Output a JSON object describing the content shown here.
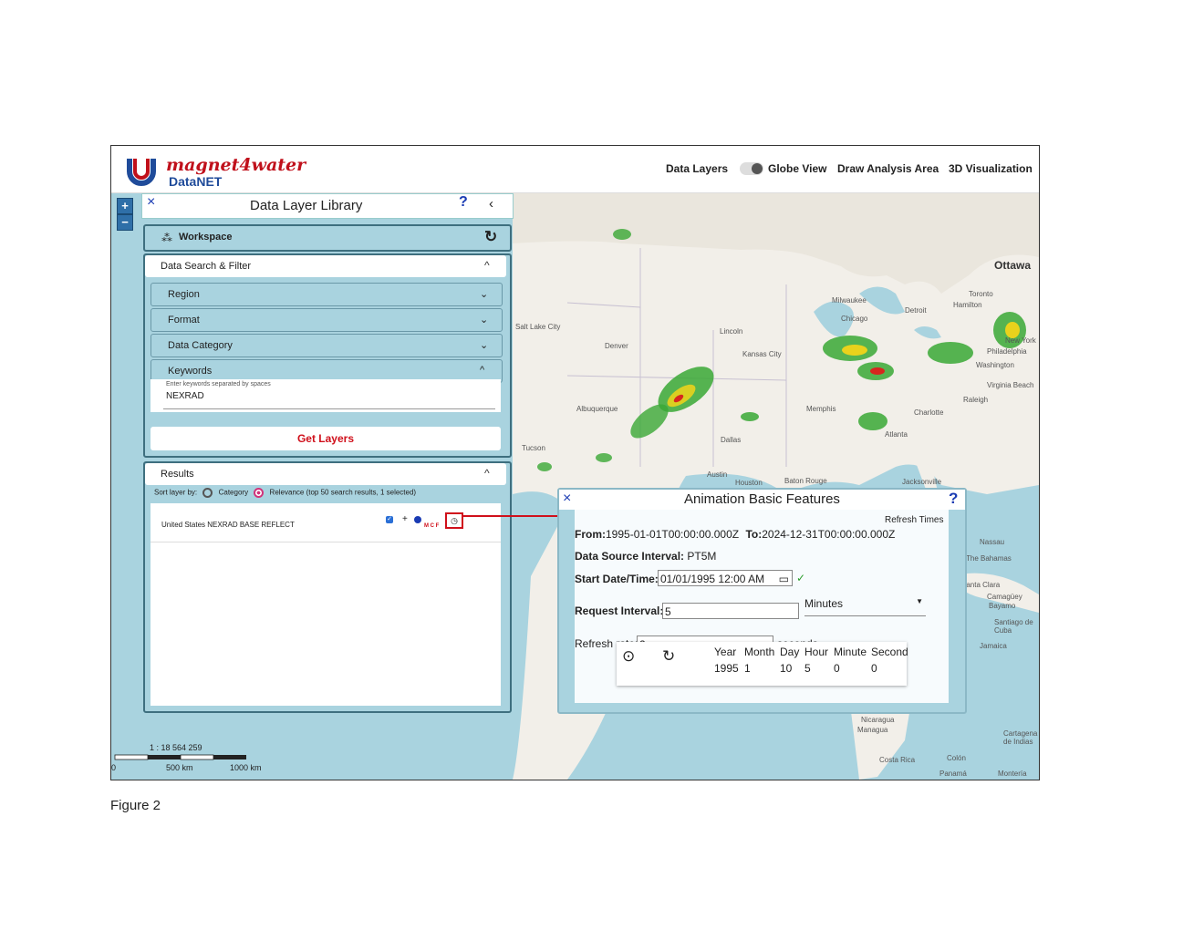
{
  "header": {
    "brand_title": "magnet4water",
    "brand_sub": "DataNET",
    "nav": [
      "Data Layers",
      "Globe View",
      "Draw Analysis Area",
      "3D Visualization"
    ]
  },
  "zoom": {
    "in": "+",
    "out": "−"
  },
  "library": {
    "title": "Data Layer Library",
    "help": "?",
    "close": "×",
    "collapse": "‹",
    "workspace": "Workspace",
    "search_title": "Data Search & Filter",
    "filters": [
      "Region",
      "Format",
      "Data Category",
      "Keywords"
    ],
    "keywords_hint": "Enter keywords separated by spaces",
    "keywords_value": "NEXRAD",
    "get_layers": "Get Layers",
    "results_title": "Results",
    "sort_label": "Sort layer by:",
    "sort_category": "Category",
    "sort_relevance": "Relevance (top 50 search results, 1 selected)",
    "result_name": "United States NEXRAD BASE REFLECT",
    "result_flags": "M C F"
  },
  "animation": {
    "title": "Animation Basic Features",
    "close": "×",
    "help": "?",
    "refresh_times": "Refresh Times",
    "from_label": "From:",
    "from_value": "1995-01-01T00:00:00.000Z",
    "to_label": "To:",
    "to_value": "2024-12-31T00:00:00.000Z",
    "interval_label": "Data Source Interval:",
    "interval_value": "PT5M",
    "start_label": "Start Date/Time:",
    "start_value": "01/01/1995 12:00 AM",
    "request_label": "Request Interval:",
    "request_value": "5",
    "request_unit": "Minutes",
    "refresh_label": "Refresh rate:",
    "refresh_value": "2",
    "refresh_unit": "seconds",
    "time_headers": [
      "Year",
      "Month",
      "Day",
      "Hour",
      "Minute",
      "Second"
    ],
    "time_values": [
      "1995",
      "1",
      "10",
      "5",
      "0",
      "0"
    ]
  },
  "map_labels": {
    "ottawa": "Ottawa",
    "toronto": "Toronto",
    "hamilton": "Hamilton",
    "detroit": "Detroit",
    "milwaukee": "Milwaukee",
    "chicago": "Chicago",
    "lincoln": "Lincoln",
    "kansas_city": "Kansas City",
    "denver": "Denver",
    "albuquerque": "Albuquerque",
    "memphis": "Memphis",
    "atlanta": "Atlanta",
    "charlotte": "Charlotte",
    "raleigh": "Raleigh",
    "dallas": "Dallas",
    "austin": "Austin",
    "houston": "Houston",
    "baton_rouge": "Baton Rouge",
    "jacksonville": "Jacksonville",
    "tucson": "Tucson",
    "washington": "Washington",
    "new_york": "New York",
    "philadelphia": "Philadelphia",
    "nassau": "Nassau",
    "the_bahamas": "The Bahamas",
    "bayamo": "Bayamo",
    "jamaica": "Jamaica",
    "managua": "Managua",
    "costa_rica": "Costa Rica",
    "panama": "Panamá",
    "monteria": "Montería",
    "cartagena": "Cartagena de Indias",
    "colon": "Colón",
    "nicaragua": "Nicaragua",
    "santiago_cuba": "Santiago de Cuba",
    "santa_clara": "Santa Clara",
    "camaguey": "Camagüey",
    "salt_lake": "Salt Lake City",
    "virginia_beach": "Virginia Beach"
  },
  "scale": {
    "ratio": "1 : 18 564 259",
    "zero": "0",
    "mid": "500 km",
    "max": "1000 km"
  },
  "caption": "Figure 2",
  "colors": {
    "brand_red": "#c0101b",
    "brand_blue": "#1f4b9a",
    "panel": "#a9d3df",
    "link_blue": "#1a3bb3"
  }
}
